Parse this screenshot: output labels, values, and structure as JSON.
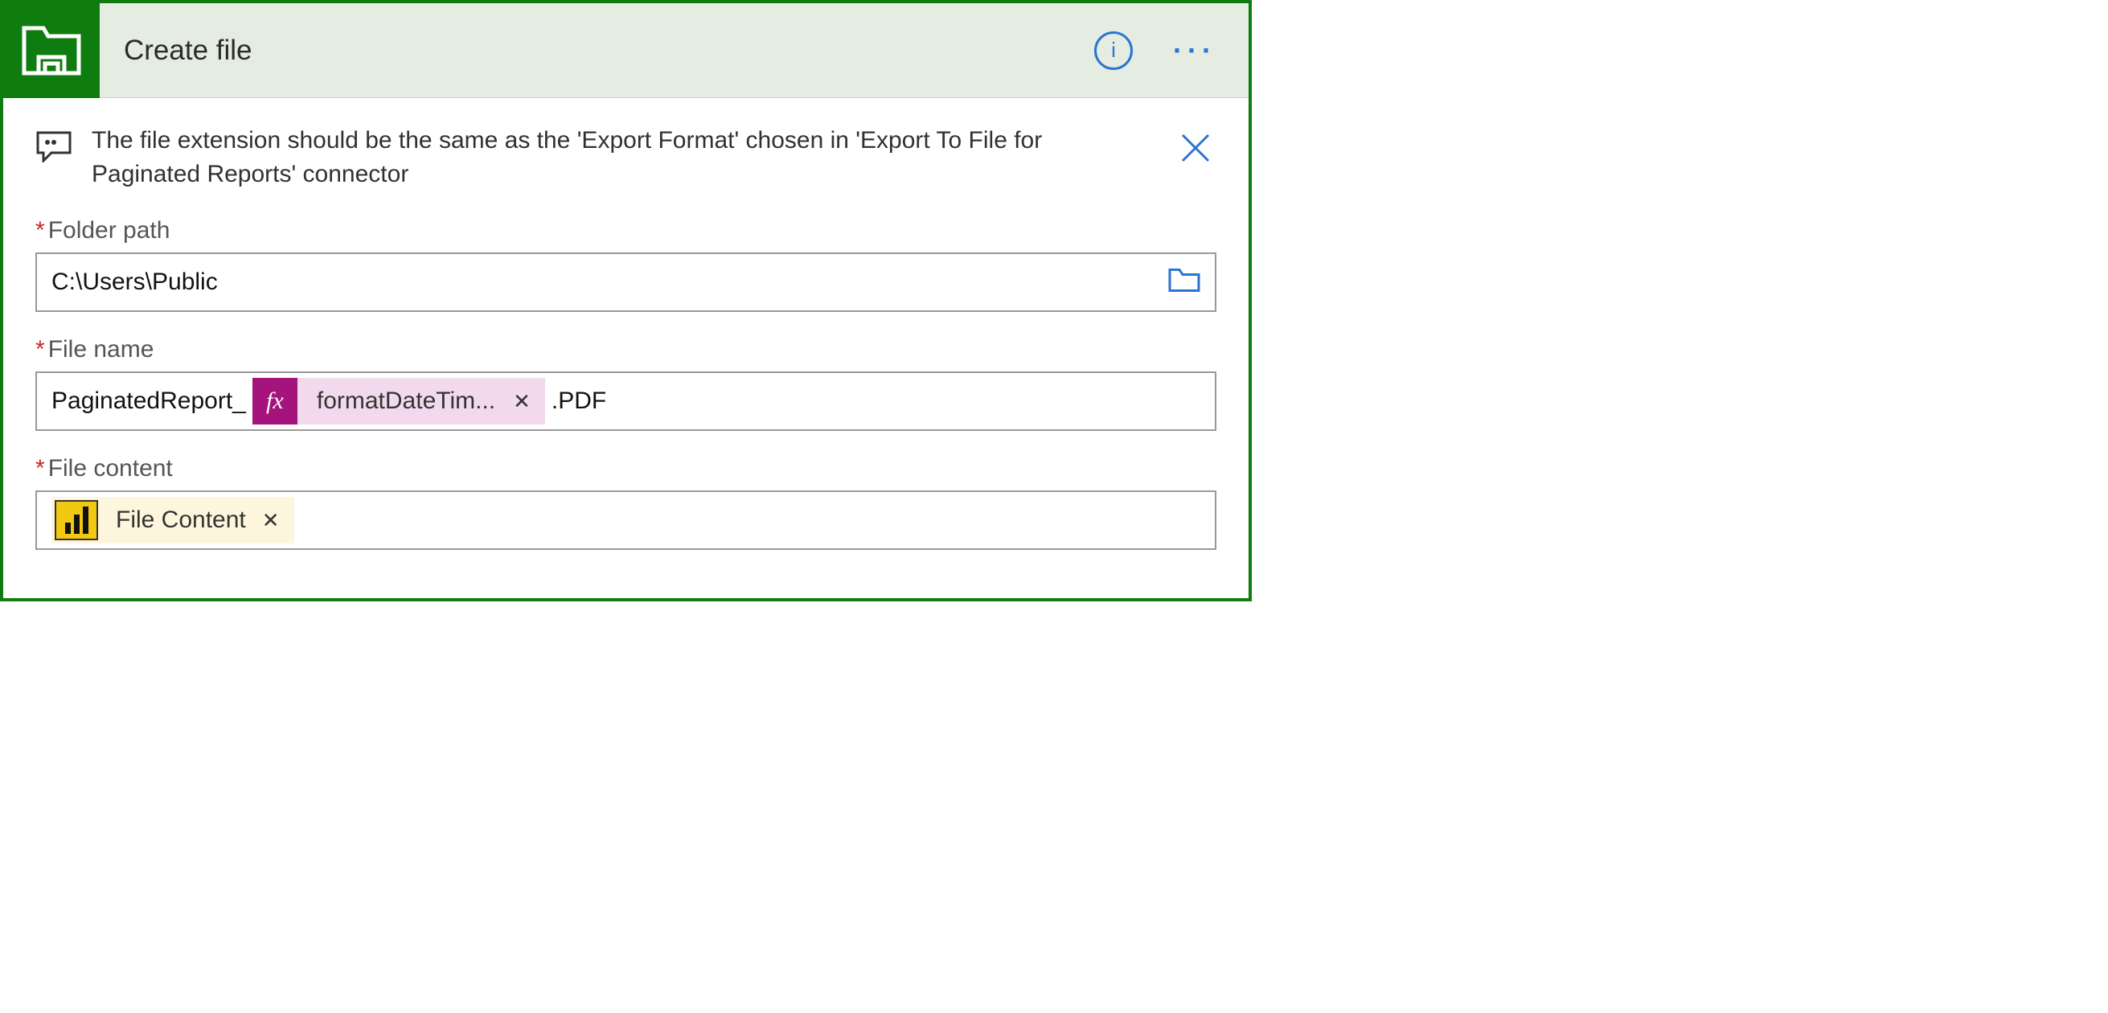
{
  "header": {
    "title": "Create file"
  },
  "note": {
    "text": "The file extension should be the same as the 'Export Format' chosen in 'Export To File for Paginated Reports' connector"
  },
  "fields": {
    "folderPath": {
      "label": "Folder path",
      "value": "C:\\Users\\Public"
    },
    "fileName": {
      "label": "File name",
      "prefix": "PaginatedReport_",
      "expressionToken": "formatDateTim...",
      "suffix": ".PDF"
    },
    "fileContent": {
      "label": "File content",
      "token": "File Content"
    }
  },
  "icons": {
    "fx": "fx",
    "info": "i"
  }
}
